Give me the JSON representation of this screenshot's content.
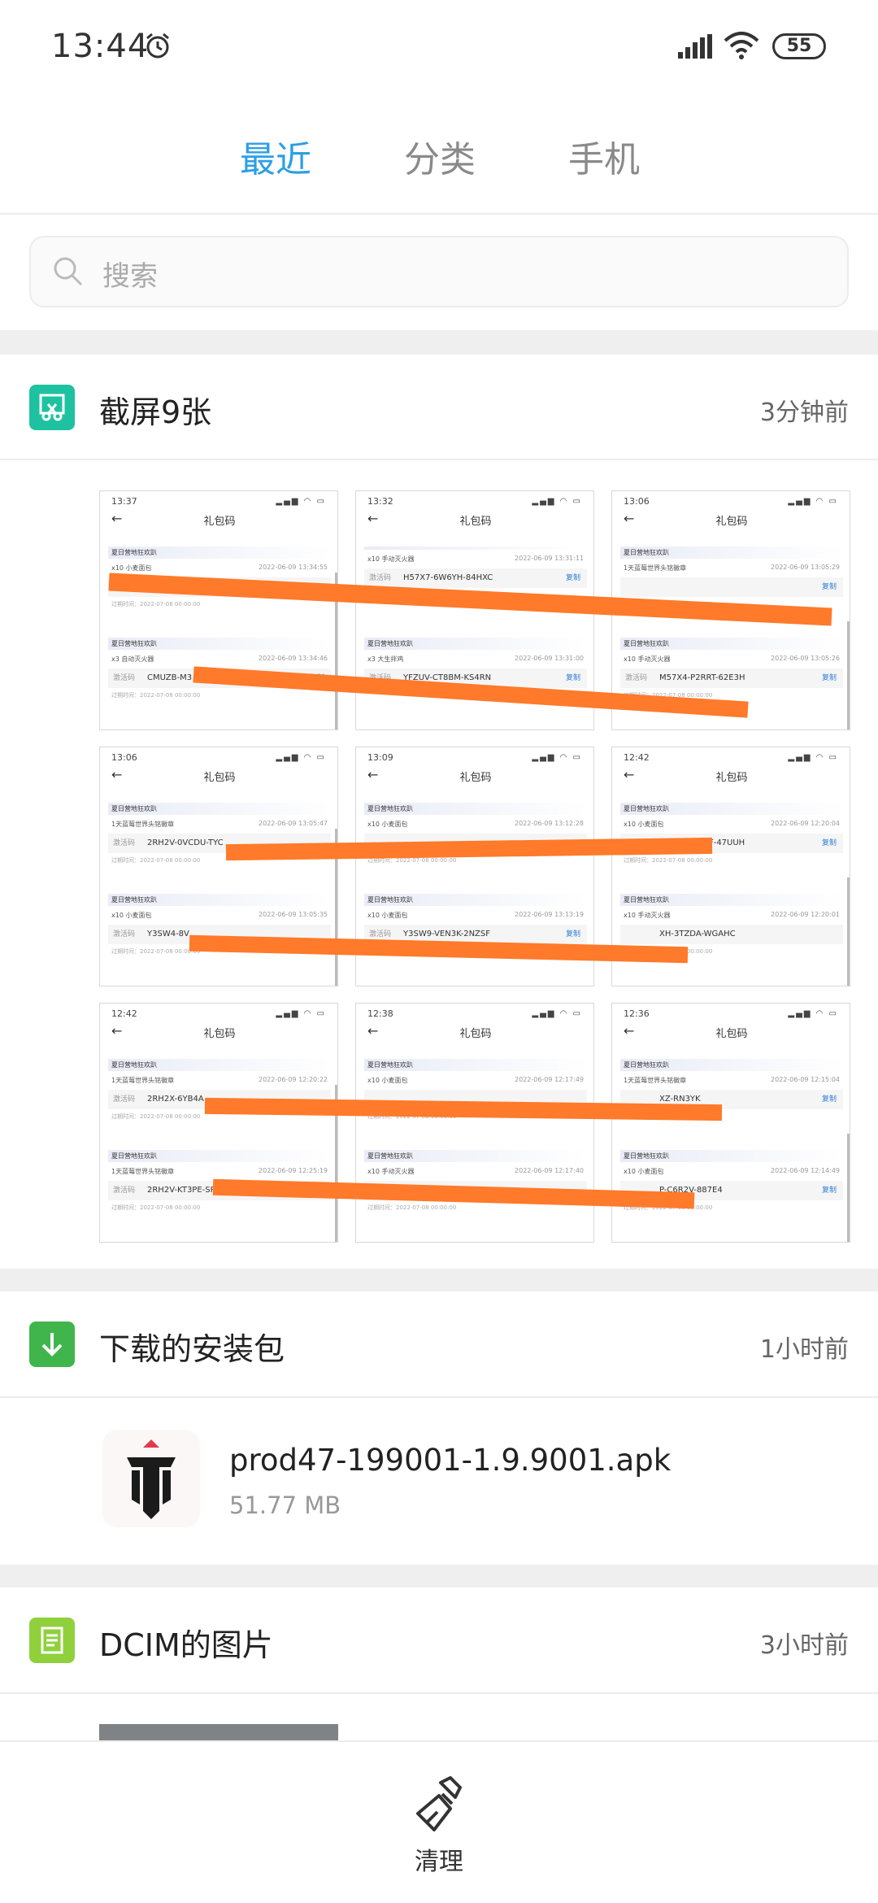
{
  "status_bar": {
    "time": "13:44",
    "battery": "55"
  },
  "tabs": [
    {
      "label": "最近",
      "active": true
    },
    {
      "label": "分类",
      "active": false
    },
    {
      "label": "手机",
      "active": false
    }
  ],
  "search": {
    "placeholder": "搜索"
  },
  "sections": {
    "screenshots": {
      "title": "截屏9张",
      "time": "3分钟前",
      "icon_color": "#1fc2a0"
    },
    "downloads": {
      "title": "下载的安装包",
      "time": "1小时前",
      "icon_color": "#3fb54c"
    },
    "dcim": {
      "title": "DCIM的图片",
      "time": "3小时前",
      "icon_color": "#8fd03c"
    }
  },
  "thumbnails": [
    {
      "time": "13:37",
      "title": "礼包码",
      "cards": [
        {
          "head": "夏日营地狂欢趴",
          "sub": "x10 小麦面包",
          "date": "2022-06-09 13:34:55",
          "label": "",
          "code": "",
          "copy": "",
          "exp": "过期时间：2022-07-08 00:00:00"
        },
        {
          "head": "夏日营地狂欢趴",
          "sub": "x3 自动灭火器",
          "date": "2022-06-09 13:34:46",
          "label": "激活码",
          "code": "CMUZB-M3",
          "copy": "复制",
          "exp": "过期时间：2022-07-08 00:00:00"
        }
      ]
    },
    {
      "time": "13:32",
      "title": "礼包码",
      "cards": [
        {
          "head": "",
          "sub": "x10 手动灭火器",
          "date": "2022-06-09 13:31:11",
          "label": "激活码",
          "code": "H57X7-6W6YH-84HXC",
          "copy": "复制",
          "exp": ""
        },
        {
          "head": "夏日营地狂欢趴",
          "sub": "x3 大生拌鸡",
          "date": "2022-06-09 13:31:00",
          "label": "激活码",
          "code": "YFZUV-CT8BM-KS4RN",
          "copy": "复制",
          "exp": ""
        }
      ]
    },
    {
      "time": "13:06",
      "title": "礼包码",
      "cards": [
        {
          "head": "夏日营地狂欢趴",
          "sub": "1天蓝莓世界头铭徽章",
          "date": "2022-06-09 13:05:29",
          "label": "",
          "code": "",
          "copy": "复制",
          "exp": "过期时间：2022-07-08 00:00:00"
        },
        {
          "head": "夏日营地狂欢趴",
          "sub": "x10 手动灭火器",
          "date": "2022-06-09 13:05:26",
          "label": "激活码",
          "code": "M57X4-P2RRT-62E3H",
          "copy": "复制",
          "exp": "过期时间：2022-07-08 00:00:00"
        }
      ]
    },
    {
      "time": "13:06",
      "title": "礼包码",
      "cards": [
        {
          "head": "夏日营地狂欢趴",
          "sub": "1天蓝莓世界头铭徽章",
          "date": "2022-06-09 13:05:47",
          "label": "激活码",
          "code": "2RH2V-0VCDU-TYC",
          "copy": "",
          "exp": "过期时间：2022-07-08 00:00:00"
        },
        {
          "head": "夏日营地狂欢趴",
          "sub": "x10 小麦面包",
          "date": "2022-06-09 13:05:35",
          "label": "激活码",
          "code": "Y3SW4-8V",
          "copy": "",
          "exp": "过期时间：2022-07-08 00:00:00"
        }
      ]
    },
    {
      "time": "13:09",
      "title": "礼包码",
      "cards": [
        {
          "head": "夏日营地狂欢趴",
          "sub": "x10 小麦面包",
          "date": "2022-06-09 13:12:28",
          "label": "",
          "code": "",
          "copy": "",
          "exp": "过期时间：2022-07-08 00:00:00"
        },
        {
          "head": "夏日营地狂欢趴",
          "sub": "x10 小麦面包",
          "date": "2022-06-09 13:13:19",
          "label": "激活码",
          "code": "Y3SW9-VEN3K-2NZSF",
          "copy": "复制",
          "exp": "过期时间：2022-07-08 00:00:00"
        }
      ]
    },
    {
      "time": "12:42",
      "title": "礼包码",
      "cards": [
        {
          "head": "夏日营地狂欢趴",
          "sub": "x10 小麦面包",
          "date": "2022-06-09 12:20:04",
          "label": "激活码",
          "code": "AFNSF-46YSF-47UUH",
          "copy": "复制",
          "exp": "过期时间：2022-07-08 00:00:00"
        },
        {
          "head": "夏日营地狂欢趴",
          "sub": "x10 手动灭火器",
          "date": "2022-06-09 12:20:01",
          "label": "",
          "code": "XH-3TZDA-WGAHC",
          "copy": "",
          "exp": "过期时间：2022-07-08 00:00:00"
        }
      ]
    },
    {
      "time": "12:42",
      "title": "礼包码",
      "cards": [
        {
          "head": "夏日营地狂欢趴",
          "sub": "1天蓝莓世界头铭徽章",
          "date": "2022-06-09 12:20:22",
          "label": "激活码",
          "code": "2RH2X-6YB4A",
          "copy": "",
          "exp": "过期时间：2022-07-08 00:00:00"
        },
        {
          "head": "夏日营地狂欢趴",
          "sub": "1天蓝莓世界头铭徽章",
          "date": "2022-06-09 12:25:19",
          "label": "激活码",
          "code": "2RH2V-KT3PE-SP6GR",
          "copy": "",
          "exp": "过期时间：2022-07-08 00:00:00"
        }
      ]
    },
    {
      "time": "12:38",
      "title": "礼包码",
      "cards": [
        {
          "head": "夏日营地狂欢趴",
          "sub": "x10 小麦面包",
          "date": "2022-06-09 12:17:49",
          "label": "",
          "code": "",
          "copy": "",
          "exp": "过期时间：2022-07-08 00:00:00"
        },
        {
          "head": "夏日营地狂欢趴",
          "sub": "x10 手动灭火器",
          "date": "2022-06-09 12:17:40",
          "label": "",
          "code": "",
          "copy": "",
          "exp": "过期时间：2022-07-08 00:00:00"
        }
      ]
    },
    {
      "time": "12:36",
      "title": "礼包码",
      "cards": [
        {
          "head": "夏日营地狂欢趴",
          "sub": "1天蓝莓世界头铭徽章",
          "date": "2022-06-09 12:15:04",
          "label": "",
          "code": "XZ-RN3YK",
          "copy": "复制",
          "exp": "过期时间：2022-07-08 00:00:00"
        },
        {
          "head": "夏日营地狂欢趴",
          "sub": "x10 小麦面包",
          "date": "2022-06-09 12:14:49",
          "label": "",
          "code": "P-C6R2V-887E4",
          "copy": "复制",
          "exp": "过期时间：2022-07-08 00:00:00"
        }
      ]
    }
  ],
  "download_file": {
    "name": "prod47-199001-1.9.9001.apk",
    "size": "51.77 MB"
  },
  "bottom_bar": {
    "clean_label": "清理"
  }
}
